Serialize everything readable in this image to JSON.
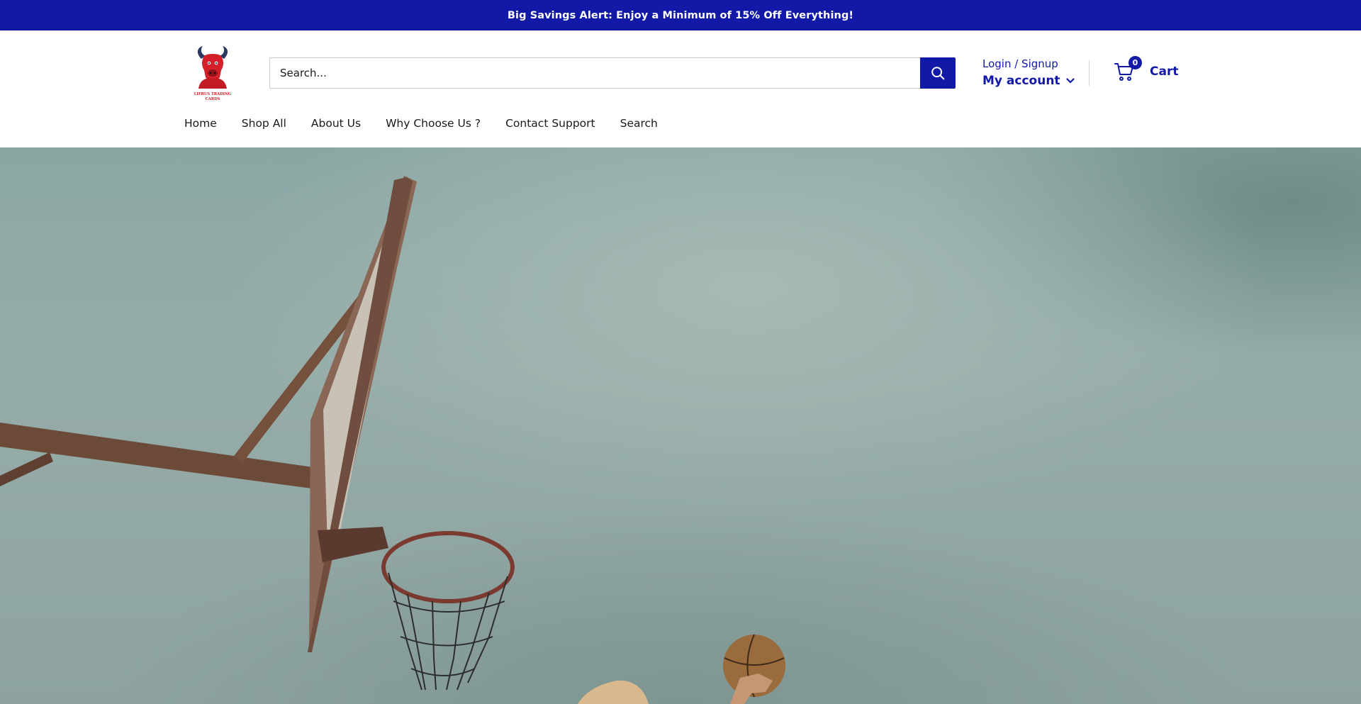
{
  "announcement": {
    "text": "Big Savings Alert: Enjoy a Minimum of 15% Off Everything!"
  },
  "header": {
    "logo_text_line1": "LIFRUS TRADING",
    "logo_text_line2": "CARDS",
    "search": {
      "placeholder": "Search...",
      "icon": "search-icon"
    },
    "account": {
      "login_label": "Login / Signup",
      "my_account_label": "My account",
      "chevron_icon": "chevron-down-icon"
    },
    "cart": {
      "count": "0",
      "label": "Cart",
      "icon": "cart-icon"
    }
  },
  "nav": {
    "items": [
      {
        "label": "Home"
      },
      {
        "label": "Shop All"
      },
      {
        "label": "About Us"
      },
      {
        "label": "Why Choose Us ?"
      },
      {
        "label": "Contact Support"
      },
      {
        "label": "Search"
      }
    ]
  },
  "colors": {
    "brand": "#1119a6",
    "logo_red": "#d4202a",
    "hero_sky": "#96aca9"
  }
}
